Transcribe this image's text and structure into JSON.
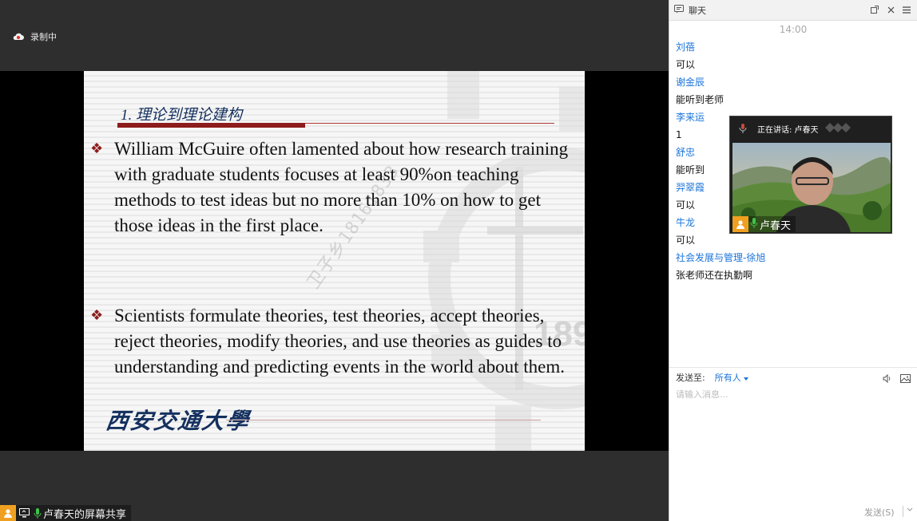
{
  "meeting": {
    "recording_label": "录制中",
    "share_label": "卢春天的屏幕共享"
  },
  "slide": {
    "title": "1. 理论到理论建构",
    "bullet_marker": "❖",
    "bullets": [
      "William McGuire often lamented about how research training with graduate students focuses at least 90%on teaching methods to test ideas but no more than 10% on how to get those ideas in the first place.",
      "Scientists formulate theories, test theories, accept theories, reject theories, modify theories, and use theories as guides to understanding and predicting events in the world about them."
    ],
    "watermark": "卫子乡18161833",
    "bg_number": "189",
    "university_logo": "西安交通大學"
  },
  "chat": {
    "title": "聊天",
    "time": "14:00",
    "messages": [
      {
        "sender": "刘蓓",
        "content": "可以"
      },
      {
        "sender": "谢金辰",
        "content": "能听到老师"
      },
      {
        "sender": "李来运",
        "content": "1"
      },
      {
        "sender": "舒忠",
        "content": "能听到"
      },
      {
        "sender": "羿翠霞",
        "content": "可以"
      },
      {
        "sender": "牛龙",
        "content": "可以"
      },
      {
        "sender": "社会发展与管理-徐旭",
        "content": "张老师还在执勤啊"
      }
    ],
    "send_to_label": "发送至:",
    "send_to_target": "所有人",
    "input_placeholder": "请输入消息...",
    "send_button": "发送(S)"
  },
  "video": {
    "speaking_label": "正在讲话: 卢春天",
    "name": "卢春天"
  },
  "colors": {
    "accent_blue": "#1a73d9",
    "slide_red": "#8d1c1c",
    "slide_navy": "#14305e",
    "avatar_orange": "#f0a020"
  }
}
